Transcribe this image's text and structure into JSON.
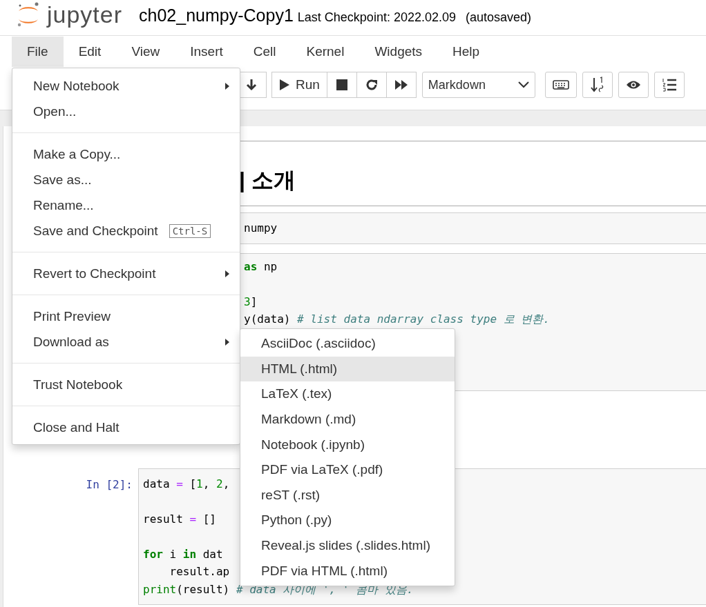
{
  "header": {
    "logo_text": "jupyter",
    "title": "ch02_numpy-Copy1",
    "checkpoint": "Last Checkpoint: 2022.02.09",
    "autosave": "(autosaved)"
  },
  "menubar": [
    {
      "label": "File",
      "selected": true
    },
    {
      "label": "Edit",
      "selected": false
    },
    {
      "label": "View",
      "selected": false
    },
    {
      "label": "Insert",
      "selected": false
    },
    {
      "label": "Cell",
      "selected": false
    },
    {
      "label": "Kernel",
      "selected": false
    },
    {
      "label": "Widgets",
      "selected": false
    },
    {
      "label": "Help",
      "selected": false
    }
  ],
  "toolbar": {
    "run_label": "Run",
    "cell_type": "Markdown"
  },
  "cells": [
    {
      "kind": "markdown",
      "heading": "| 소개"
    },
    {
      "kind": "code",
      "covered": true,
      "lines": [
        {
          "kind": "code",
          "tokens": [
            {
              "kind": "plain",
              "s": "numpy"
            }
          ]
        }
      ]
    },
    {
      "kind": "code",
      "covered": true,
      "lines": [
        {
          "kind": "code",
          "tokens": [
            {
              "kind": "keyword",
              "s": "as"
            },
            {
              "kind": "plain",
              "s": " np"
            }
          ]
        },
        {
          "kind": "blank"
        },
        {
          "kind": "code",
          "tokens": [
            {
              "kind": "number",
              "s": "3"
            },
            {
              "kind": "plain",
              "s": "]"
            }
          ]
        },
        {
          "kind": "code",
          "tokens": [
            {
              "kind": "plain",
              "s": "y(data) "
            },
            {
              "kind": "comment",
              "s": "# list data ndarray class type 로 변환."
            }
          ]
        }
      ]
    },
    {
      "kind": "blank"
    },
    {
      "kind": "code",
      "prompt": "In [2]:",
      "lines": [
        {
          "kind": "code",
          "tokens": [
            {
              "kind": "plain",
              "s": "data "
            },
            {
              "kind": "op",
              "s": "="
            },
            {
              "kind": "plain",
              "s": " ["
            },
            {
              "kind": "number",
              "s": "1"
            },
            {
              "kind": "plain",
              "s": ", "
            },
            {
              "kind": "number",
              "s": "2"
            },
            {
              "kind": "plain",
              "s": ","
            }
          ]
        },
        {
          "kind": "blank"
        },
        {
          "kind": "code",
          "tokens": [
            {
              "kind": "plain",
              "s": "result "
            },
            {
              "kind": "op",
              "s": "="
            },
            {
              "kind": "plain",
              "s": " []"
            }
          ]
        },
        {
          "kind": "blank"
        },
        {
          "kind": "code",
          "tokens": [
            {
              "kind": "keyword",
              "s": "for"
            },
            {
              "kind": "plain",
              "s": " i "
            },
            {
              "kind": "keyword",
              "s": "in"
            },
            {
              "kind": "plain",
              "s": " dat"
            }
          ]
        },
        {
          "kind": "code",
          "tokens": [
            {
              "kind": "plain",
              "s": "    result.ap"
            }
          ]
        },
        {
          "kind": "code",
          "tokens": [
            {
              "kind": "builtin",
              "s": "print"
            },
            {
              "kind": "plain",
              "s": "(result) "
            },
            {
              "kind": "comment",
              "s": "# data 사이에 ', ' 콤마 있음."
            }
          ]
        }
      ]
    }
  ],
  "file_menu": [
    {
      "kind": "item",
      "label": "New Notebook",
      "submenu": true
    },
    {
      "kind": "item",
      "label": "Open...",
      "submenu": false
    },
    {
      "kind": "divider"
    },
    {
      "kind": "item",
      "label": "Make a Copy...",
      "submenu": false
    },
    {
      "kind": "item",
      "label": "Save as...",
      "submenu": false
    },
    {
      "kind": "item",
      "label": "Rename...",
      "submenu": false
    },
    {
      "kind": "item",
      "label": "Save and Checkpoint",
      "submenu": false,
      "shortcut": "Ctrl-S"
    },
    {
      "kind": "divider"
    },
    {
      "kind": "item",
      "label": "Revert to Checkpoint",
      "submenu": true
    },
    {
      "kind": "divider"
    },
    {
      "kind": "item",
      "label": "Print Preview",
      "submenu": false
    },
    {
      "kind": "item",
      "label": "Download as",
      "submenu": true
    },
    {
      "kind": "divider"
    },
    {
      "kind": "item",
      "label": "Trust Notebook",
      "submenu": false
    },
    {
      "kind": "divider"
    },
    {
      "kind": "item",
      "label": "Close and Halt",
      "submenu": false
    }
  ],
  "download_menu": [
    {
      "label": "AsciiDoc (.asciidoc)",
      "selected": false
    },
    {
      "label": "HTML (.html)",
      "selected": true
    },
    {
      "label": "LaTeX (.tex)",
      "selected": false
    },
    {
      "label": "Markdown (.md)",
      "selected": false
    },
    {
      "label": "Notebook (.ipynb)",
      "selected": false
    },
    {
      "label": "PDF via LaTeX (.pdf)",
      "selected": false
    },
    {
      "label": "reST (.rst)",
      "selected": false
    },
    {
      "label": "Python (.py)",
      "selected": false
    },
    {
      "label": "Reveal.js slides (.slides.html)",
      "selected": false
    },
    {
      "label": "PDF via HTML (.html)",
      "selected": false
    }
  ]
}
